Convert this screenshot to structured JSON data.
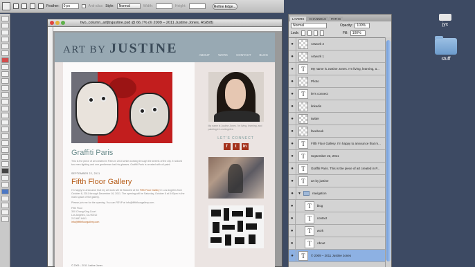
{
  "options_bar": {
    "feather_label": "Feather:",
    "feather_value": "0 px",
    "antialias_label": "Anti-alias",
    "style_label": "Style:",
    "style_value": "Normal",
    "width_label": "Width:",
    "height_label": "Height:",
    "refine_label": "Refine Edge..."
  },
  "document": {
    "title": "two_column_art|byjustine.psd @ 66.7% (© 2009 – 2011 Justine Jones, RGB/8)"
  },
  "site": {
    "logo_prefix": "ART BY ",
    "logo_name": "JUSTINE",
    "nav": [
      "ABOUT",
      "WORK",
      "CONTACT",
      "BLOG"
    ],
    "post1_title": "Graffiti Paris",
    "post1_body": "This is the piece of art created in Paris in 2010 while working through the streets of the city. It noticed two men fighting and one gentleman lost his glasses. Graffiti Paris is created with oil paint.",
    "post2_date": "SEPTEMBER 22, 2011",
    "post2_title": "Fifth Floor Gallery",
    "post2_body_1a": "I'm happy to announce that my art work will be featured at the ",
    "post2_body_1b": "Fifth Floor Gallery",
    "post2_body_1c": " in Los Angeles from October 8, 2011 through December 16, 2011. The opening will be Saturday, October 8 at 8:00pm in the main space of the gallery.",
    "post2_body_2": "Please join me for the opening. You can RSVP at info@fifthfloorgallery.com.",
    "address_1": "Fifth Floor",
    "address_2": "300 Chung King Court",
    "address_3": "Los Angeles, CA 90012",
    "address_4": "213.687.8441",
    "address_5": "info@fifthfloorgallery.com",
    "bio": "My name is Justine Jones. I'm living, learning, and painting in Los Angeles.",
    "connect_heading": "LET'S CONNECT",
    "social": [
      "f",
      "t",
      "in"
    ],
    "footer": "© 2009 – 2011 Justine Jones"
  },
  "layers_panel": {
    "tabs": [
      "LAYERS",
      "CHANNELS",
      "PATHS"
    ],
    "blend_mode": "Normal",
    "opacity_label": "Opacity:",
    "opacity_value": "100%",
    "lock_label": "Lock:",
    "fill_label": "Fill:",
    "fill_value": "100%",
    "layers": [
      {
        "name": "Artwork 2",
        "type": "image"
      },
      {
        "name": "Artwork 1",
        "type": "image"
      },
      {
        "name": "My name is Justine Jones. I'm living, learning, a...",
        "type": "text"
      },
      {
        "name": "Photo",
        "type": "image"
      },
      {
        "name": "let's connect",
        "type": "text"
      },
      {
        "name": "linkedin",
        "type": "image"
      },
      {
        "name": "twitter",
        "type": "image"
      },
      {
        "name": "facebook",
        "type": "image"
      },
      {
        "name": "Fifth Floor Gallery. I'm happy to announce that m...",
        "type": "text"
      },
      {
        "name": "September 22, 2011",
        "type": "text"
      },
      {
        "name": "Graffiti Paris. This is the piece of art created in P...",
        "type": "text"
      },
      {
        "name": "art by justine",
        "type": "text"
      },
      {
        "name": "navigation",
        "type": "group"
      },
      {
        "name": "blog",
        "type": "text",
        "child": true
      },
      {
        "name": "contact",
        "type": "text",
        "child": true
      },
      {
        "name": "work",
        "type": "text",
        "child": true
      },
      {
        "name": "About",
        "type": "text",
        "child": true
      },
      {
        "name": "© 2009 – 2011 Justine Jones",
        "type": "text",
        "selected": true
      }
    ]
  },
  "desktop": {
    "item1": "jyc",
    "item2": "stuff"
  }
}
